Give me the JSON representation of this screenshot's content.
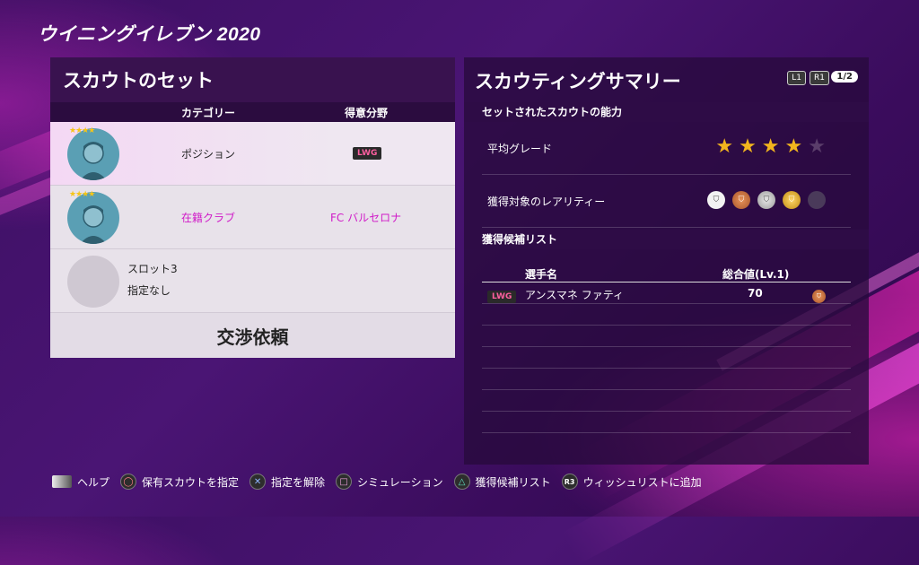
{
  "logo": "ウイニングイレブン 2020",
  "left": {
    "title": "スカウトのセット",
    "col_category": "カテゴリー",
    "col_specialty": "得意分野",
    "rows": [
      {
        "category": "ポジション",
        "specialty": "LWG",
        "stars": "★★★★"
      },
      {
        "category": "在籍クラブ",
        "specialty": "FC バルセロナ",
        "stars": "★★★★"
      },
      {
        "slot": "スロット3",
        "status": "指定なし"
      }
    ],
    "negotiate": "交渉依頼"
  },
  "right": {
    "title": "スカウティングサマリー",
    "btn_l1": "L1",
    "btn_r1": "R1",
    "pager": "1/2",
    "section1": "セットされたスカウトの能力",
    "avg_grade_label": "平均グレード",
    "avg_grade_value": 4,
    "avg_grade_max": 5,
    "rarity_label": "獲得対象のレアリティー",
    "rarity_colors": {
      "white": "#f2f2f2",
      "bronze": "#c16a35",
      "silver": "#b5b5b5",
      "gold": "#e6ad2a",
      "empty": "#4a3a5a"
    },
    "section2": "獲得候補リスト",
    "list_col_name": "選手名",
    "list_col_ovr": "総合値(Lv.1)",
    "players": [
      {
        "pos": "LWG",
        "name": "アンスマネ ファティ",
        "ovr": "70",
        "medal": "bronze-medal-icon"
      }
    ]
  },
  "footer": [
    {
      "icon": "touchpad-icon",
      "label": "ヘルプ"
    },
    {
      "icon": "circle-button-icon",
      "glyph": "◯",
      "label": "保有スカウトを指定"
    },
    {
      "icon": "cross-button-icon",
      "glyph": "✕",
      "label": "指定を解除"
    },
    {
      "icon": "square-button-icon",
      "glyph": "□",
      "label": "シミュレーション"
    },
    {
      "icon": "triangle-button-icon",
      "glyph": "△",
      "label": "獲得候補リスト"
    },
    {
      "icon": "r3-button-icon",
      "glyph": "R3",
      "label": "ウィッシュリストに追加"
    }
  ]
}
